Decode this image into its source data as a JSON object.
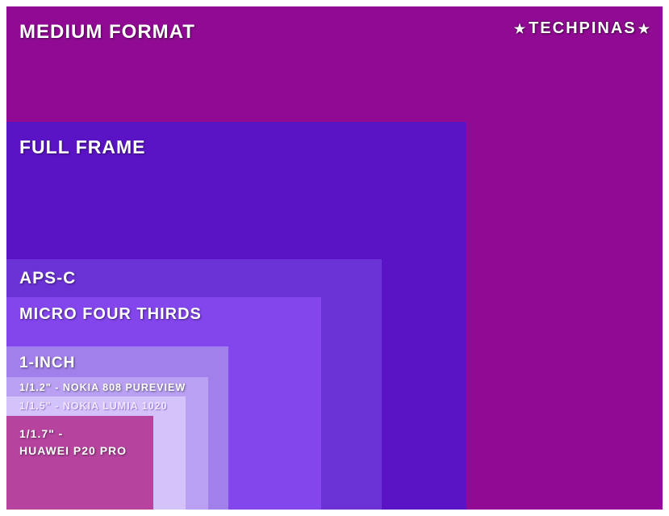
{
  "watermark": "TECHPINAS",
  "formats": {
    "medium_format": "Medium Format",
    "full_frame": "Full Frame",
    "aps_c": "APS-C",
    "micro_four_thirds": "Micro Four Thirds",
    "one_inch": "1-Inch",
    "nokia_808": "1/1.2\" - Nokia 808 Pureview",
    "nokia_1020": "1/1.5\" - Nokia Lumia 1020",
    "huawei_line1": "1/1.7\" -",
    "huawei_line2": "Huawei P20 Pro"
  }
}
